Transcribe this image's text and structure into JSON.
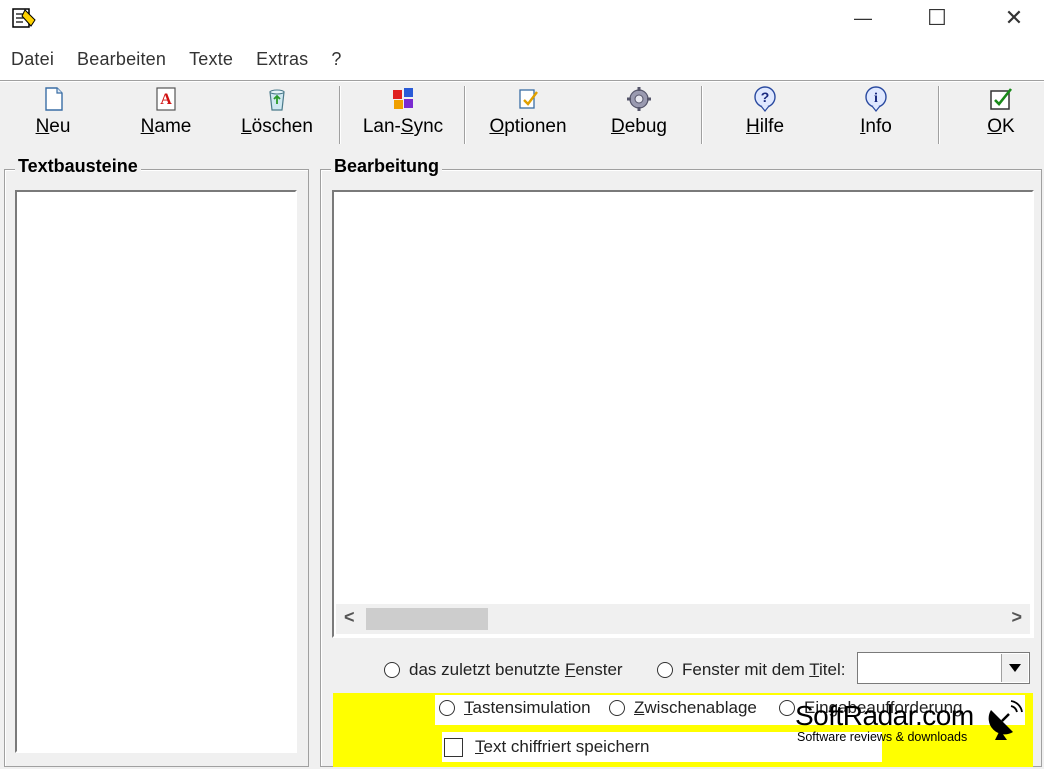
{
  "window": {
    "controls": [
      "—",
      "☐",
      "✕"
    ]
  },
  "menu": [
    "Datei",
    "Bearbeiten",
    "Texte",
    "Extras",
    "?"
  ],
  "toolbar": [
    {
      "pre": "",
      "ul": "N",
      "post": "eu",
      "icon": "new-document-icon"
    },
    {
      "pre": "",
      "ul": "N",
      "post": "ame",
      "icon": "rename-icon"
    },
    {
      "pre": "",
      "ul": "L",
      "post": "öschen",
      "icon": "recycle-bin-icon"
    },
    {
      "pre": "Lan-",
      "ul": "S",
      "post": "ync",
      "icon": "network-sync-icon"
    },
    {
      "pre": "",
      "ul": "O",
      "post": "ptionen",
      "icon": "options-icon"
    },
    {
      "pre": "",
      "ul": "D",
      "post": "ebug",
      "icon": "gear-icon"
    },
    {
      "pre": "",
      "ul": "H",
      "post": "ilfe",
      "icon": "help-icon"
    },
    {
      "pre": "",
      "ul": "I",
      "post": "nfo",
      "icon": "info-icon"
    },
    {
      "pre": "",
      "ul": "O",
      "post": "K",
      "icon": "ok-check-icon"
    }
  ],
  "left_panel": {
    "title": "Textbausteine"
  },
  "right_panel": {
    "title": "Bearbeitung"
  },
  "scroll": {
    "left": "<",
    "right": ">"
  },
  "target": {
    "last_window_pre": "das zuletzt benutzte ",
    "last_window_ul": "F",
    "last_window_post": "enster",
    "title_window_pre": "Fenster mit dem ",
    "title_window_ul": "T",
    "title_window_post": "itel:",
    "title_value": ""
  },
  "method": {
    "key_sim_ul": "T",
    "key_sim_post": "astensimulation",
    "clipboard_ul": "Z",
    "clipboard_post": "wischenablage",
    "prompt": "Eingabeaufforderung"
  },
  "encrypt": {
    "ul": "T",
    "post": "ext chiffriert speichern"
  },
  "watermark": {
    "title": "SoftRadar.com",
    "subtitle": "Software reviews & downloads"
  },
  "colors": {
    "highlight": "#ffff00",
    "window_bg": "#f0f0f0"
  }
}
